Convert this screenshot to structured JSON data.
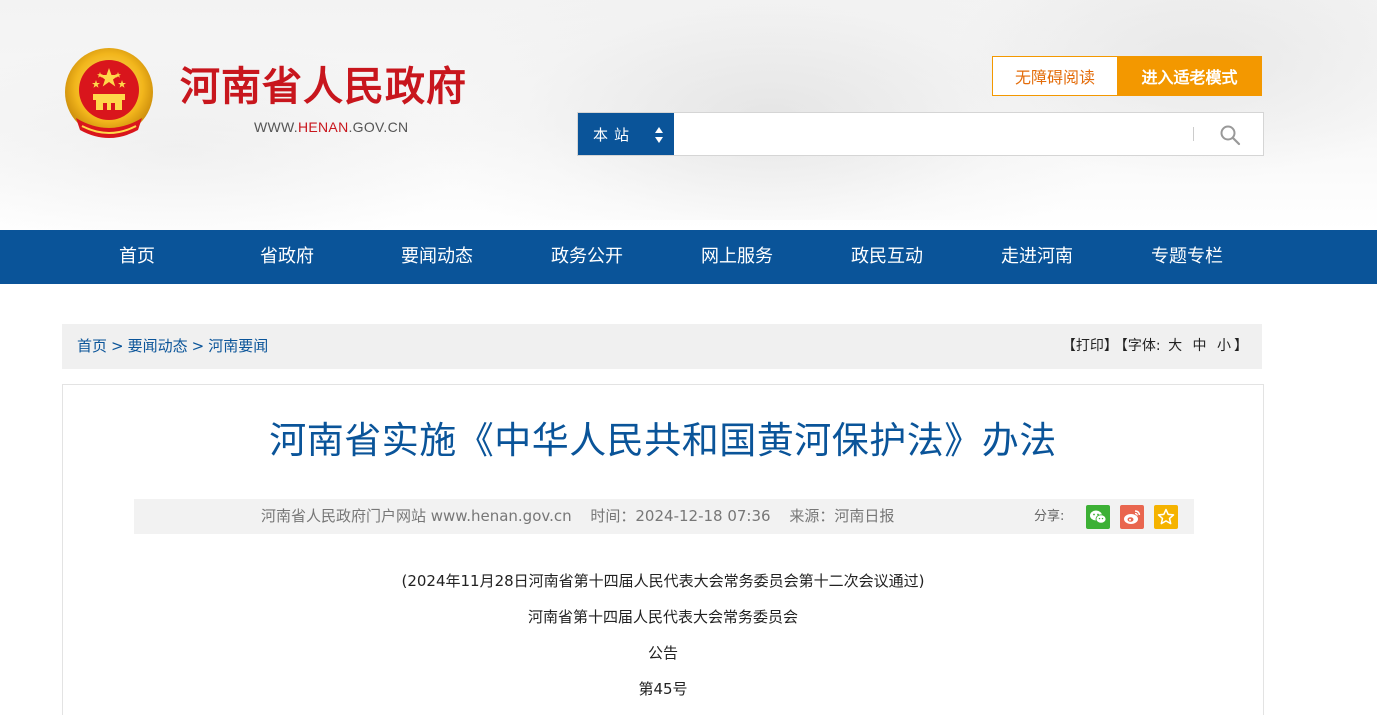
{
  "header": {
    "site_title": "河南省人民政府",
    "domain_prefix": "WWW.",
    "domain_highlight": "HENAN",
    "domain_suffix": ".GOV.CN",
    "accessibility_label": "无障碍阅读",
    "elder_mode_label": "进入适老模式",
    "search": {
      "scope_label": "本站",
      "placeholder": "",
      "icon": "search-icon"
    },
    "emblem_icon": "national-emblem-icon"
  },
  "nav": {
    "items": [
      "首页",
      "省政府",
      "要闻动态",
      "政务公开",
      "网上服务",
      "政民互动",
      "走进河南",
      "专题专栏"
    ]
  },
  "breadcrumb": {
    "items": [
      "首页",
      "要闻动态",
      "河南要闻"
    ],
    "separator": ">"
  },
  "tools": {
    "print": "【打印】",
    "font_label": "【字体:",
    "font_large": "大",
    "font_medium": "中",
    "font_small": "小",
    "font_close": "】"
  },
  "article": {
    "title": "河南省实施《中华人民共和国黄河保护法》办法",
    "meta": {
      "source_site": "河南省人民政府门户网站 www.henan.gov.cn",
      "time": "时间：2024-12-18 07:36",
      "origin": "来源：河南日报",
      "share_label": "分享:"
    },
    "share_icons": [
      "wechat-icon",
      "weibo-icon",
      "favorite-icon"
    ],
    "paragraphs": [
      "(2024年11月28日河南省第十四届人民代表大会常务委员会第十二次会议通过)",
      "河南省第十四届人民代表大会常务委员会",
      "公告",
      "第45号"
    ]
  },
  "colors": {
    "brand_blue": "#0a5499",
    "title_red": "#c8161d",
    "accent_orange": "#f39800",
    "wechat_green": "#3cb035",
    "weibo_red": "#e9664f",
    "favorite_yellow": "#f5b300"
  }
}
